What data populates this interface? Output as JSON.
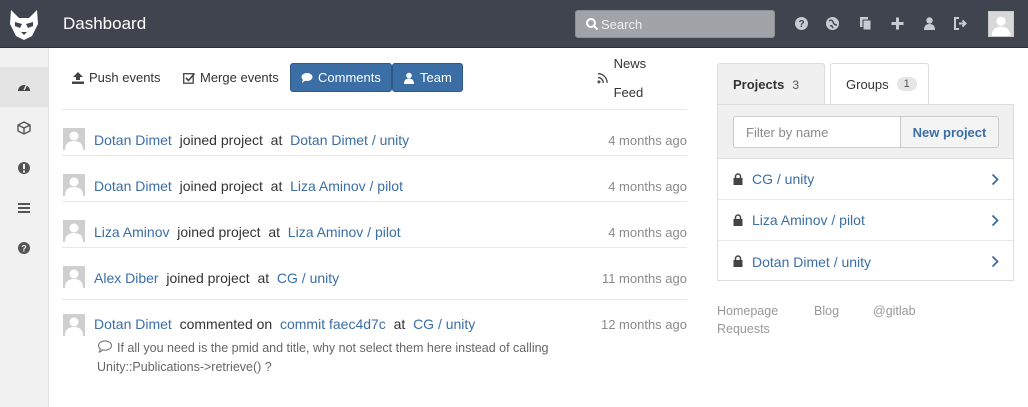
{
  "header": {
    "title": "Dashboard",
    "search_placeholder": "Search",
    "icons": [
      "help-icon",
      "globe-icon",
      "copy-icon",
      "plus-icon",
      "user-icon",
      "sign-out-icon"
    ]
  },
  "sidebar": {
    "items": [
      "dashboard-icon",
      "cube-icon",
      "exclamation-icon",
      "list-icon",
      "question-icon"
    ]
  },
  "filters": {
    "push": "Push events",
    "merge": "Merge events",
    "comments": "Comments",
    "team": "Team",
    "news_feed": "News Feed"
  },
  "events": [
    {
      "user": "Dotan Dimet",
      "action": "joined project",
      "at": "at",
      "target": "Dotan Dimet / unity",
      "time": "4 months ago"
    },
    {
      "user": "Dotan Dimet",
      "action": "joined project",
      "at": "at",
      "target": "Liza Aminov / pilot",
      "time": "4 months ago"
    },
    {
      "user": "Liza Aminov",
      "action": "joined project",
      "at": "at",
      "target": "Liza Aminov / pilot",
      "time": "4 months ago"
    },
    {
      "user": "Alex Diber",
      "action": "joined project",
      "at": "at",
      "target": "CG / unity",
      "time": "11 months ago"
    },
    {
      "user": "Dotan Dimet",
      "action": "commented on",
      "commit": "commit faec4d7c",
      "at": "at",
      "target": "CG / unity",
      "time": "12 months ago",
      "note": "If all you need is the pmid and title, why not select them here instead of calling Unity::Publications->retrieve() ?"
    }
  ],
  "right": {
    "tab_projects": "Projects",
    "projects_count": "3",
    "tab_groups": "Groups",
    "groups_count": "1",
    "filter_placeholder": "Filter by name",
    "new_project": "New project",
    "projects": [
      "CG / unity",
      "Liza Aminov / pilot",
      "Dotan Dimet / unity"
    ],
    "footer": {
      "homepage": "Homepage",
      "blog": "Blog",
      "gitlab": "@gitlab",
      "requests": "Requests"
    }
  },
  "colors": {
    "header_bg": "#3f444e",
    "link": "#3a6ea5",
    "active_filter": "#3a6ea5"
  }
}
